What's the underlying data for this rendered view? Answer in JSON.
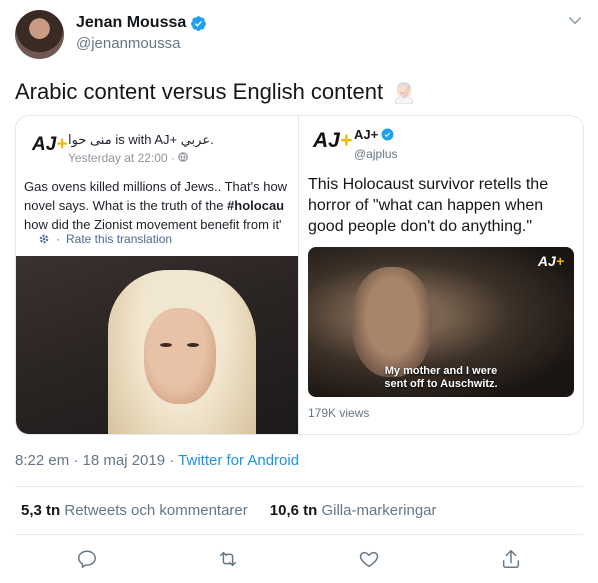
{
  "author": {
    "name": "Jenan Moussa",
    "handle": "@jenanmoussa"
  },
  "tweet": {
    "text": "Arabic content versus English content"
  },
  "left_image": {
    "logo": "AJ",
    "header": "منى حوا is with AJ+ عربي.",
    "timestamp": "Yesterday at 22:00 · ",
    "body_line1": "Gas ovens killed millions of Jews.. That's how",
    "body_line2_prefix": "novel says. What is the truth of the ",
    "body_line2_bold": "#holocau",
    "body_line3": "how did the Zionist movement benefit from it'",
    "rate_link": "Rate this translation"
  },
  "right_card": {
    "logo": "AJ",
    "name": "AJ+",
    "handle": "@ajplus",
    "text": "This Holocaust survivor retells the horror of \"what can happen when good people don't do anything.\"",
    "video_caption_line1": "My mother and I were",
    "video_caption_line2": "sent off to Auschwitz.",
    "views": "179K views"
  },
  "meta": {
    "time": "8:22 em · 18 maj 2019 · ",
    "source": "Twitter for Android"
  },
  "stats": {
    "retweets_count": "5,3 tn",
    "retweets_label": "Retweets och kommentarer",
    "likes_count": "10,6 tn",
    "likes_label": "Gilla-markeringar"
  },
  "colors": {
    "accent": "#1da1f2",
    "link": "#1b95e0",
    "muted": "#657786",
    "text": "#14171a",
    "aj_yellow": "#f5b800"
  },
  "icons": [
    "verified-icon",
    "chevron-down-icon",
    "facepalm-emoji-icon",
    "gear-icon",
    "globe-icon",
    "reply-icon",
    "retweet-icon",
    "like-icon",
    "share-icon"
  ]
}
